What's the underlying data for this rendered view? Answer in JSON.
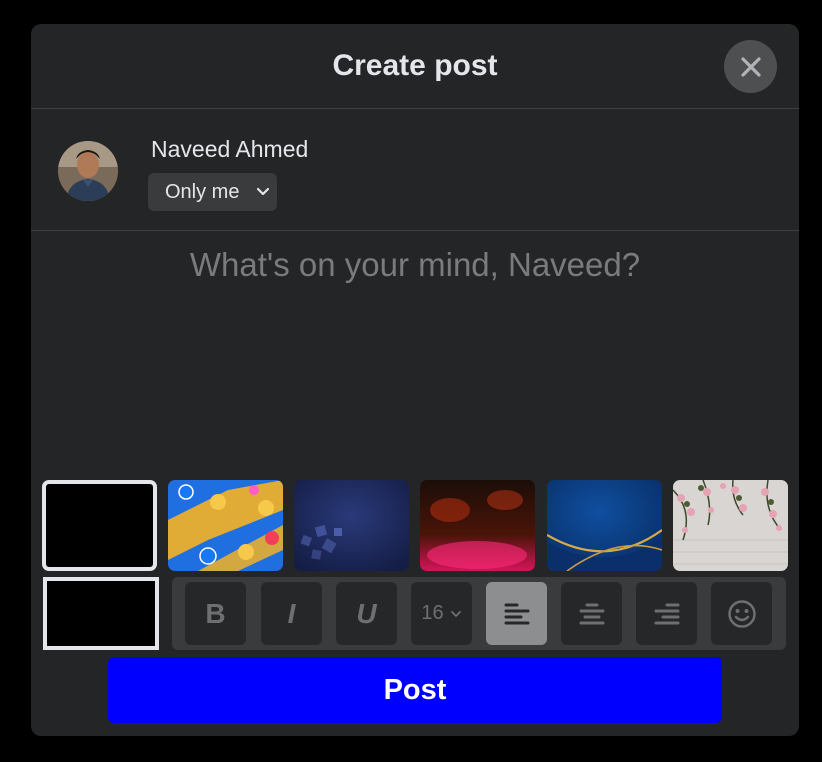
{
  "modal": {
    "title": "Create post",
    "close_icon": "close-icon"
  },
  "user": {
    "name": "Naveed Ahmed",
    "privacy": "Only me",
    "privacy_icon": "chevron-down-icon"
  },
  "composer": {
    "placeholder": "What's on your mind, Naveed?"
  },
  "backgrounds": [
    {
      "name": "plain-black",
      "selected": true
    },
    {
      "name": "emoji-reactions"
    },
    {
      "name": "dark-blue-cubes"
    },
    {
      "name": "red-pink-smoke"
    },
    {
      "name": "navy-gold-curve"
    },
    {
      "name": "pink-flowers-wall"
    }
  ],
  "toolbar": {
    "bold_label": "B",
    "italic_label": "I",
    "underline_label": "U",
    "font_size": "16",
    "align": "left",
    "icons": [
      "align-left-icon",
      "align-center-icon",
      "align-right-icon",
      "emoji-icon"
    ]
  },
  "post_button": {
    "label": "Post"
  },
  "colors": {
    "modal_bg": "#242526",
    "post_button_bg": "#0000ff",
    "text": "#e4e6eb"
  }
}
